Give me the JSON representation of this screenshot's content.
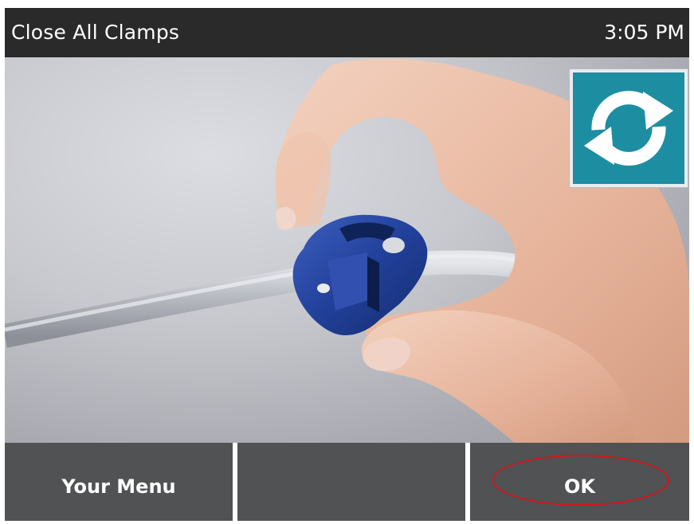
{
  "header": {
    "title": "Close All Clamps",
    "time": "3:05 PM"
  },
  "scene": {
    "illustration": "hand-closing-blue-clamp-on-tubing",
    "refresh_icon": "refresh-icon",
    "refresh_color": "#1d8ea2"
  },
  "bottom_bar": {
    "left_label": "Your Menu",
    "middle_label": "",
    "right_label": "OK",
    "highlight_color": "#d8141c"
  }
}
